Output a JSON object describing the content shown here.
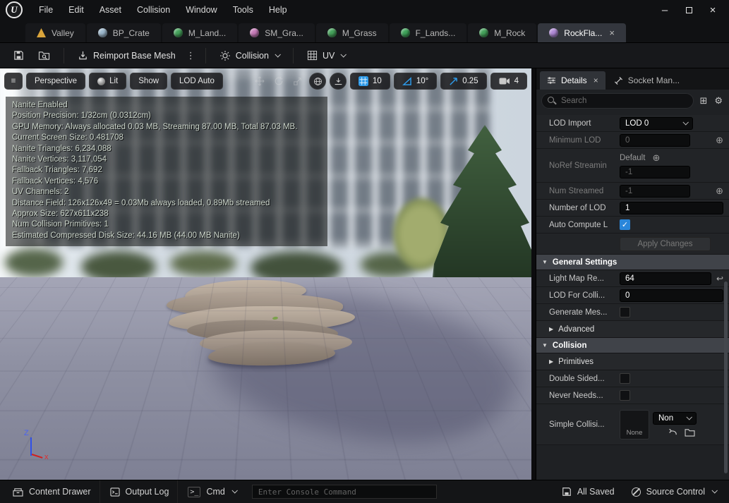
{
  "icons": {
    "logo_letter": "U",
    "hamburger": "≡",
    "gear": "⚙",
    "plus_circle": "⊕",
    "reset_arrow": "↩",
    "kebab": "⋮",
    "check": "✓",
    "close": "×",
    "minimize": "–",
    "caret_down": "▼",
    "caret_right": "▶",
    "prompt": ">_",
    "squares": "⊞"
  },
  "titlebar": {
    "menus": [
      "File",
      "Edit",
      "Asset",
      "Collision",
      "Window",
      "Tools",
      "Help"
    ]
  },
  "asset_tabs": [
    {
      "label": "Valley",
      "color": "#d9a43b",
      "active": false
    },
    {
      "label": "BP_Crate",
      "color": "#9db8cc",
      "active": false
    },
    {
      "label": "M_Land...",
      "color": "#46a35c",
      "active": false
    },
    {
      "label": "SM_Gra...",
      "color": "#c77bb8",
      "active": false
    },
    {
      "label": "M_Grass",
      "color": "#46a35c",
      "active": false
    },
    {
      "label": "F_Lands...",
      "color": "#3fa35a",
      "active": false
    },
    {
      "label": "M_Rock",
      "color": "#46a35c",
      "active": false
    },
    {
      "label": "RockFla...",
      "color": "#b08ad6",
      "active": true
    }
  ],
  "toolbar": {
    "reimport_label": "Reimport Base Mesh",
    "collision_label": "Collision",
    "uv_label": "UV"
  },
  "viewport": {
    "menu_buttons": {
      "perspective": "Perspective",
      "lit": "Lit",
      "show": "Show",
      "lod": "LOD Auto"
    },
    "snap": {
      "grid": "10",
      "angle": "10°",
      "scale": "0.25",
      "camera_speed": "4"
    },
    "stats": [
      "Nanite Enabled",
      "Position Precision: 1/32cm (0.0312cm)",
      "GPU Memory: Always allocated 0.03 MB, Streaming 87.00 MB, Total 87.03 MB.",
      "Current Screen Size: 0.481708",
      "Nanite Triangles: 6,234,088",
      "Nanite Vertices: 3,117,054",
      "Fallback Triangles: 7,692",
      "Fallback Vertices: 4,576",
      "UV Channels: 2",
      "Distance Field: 126x126x49 = 0.03Mb always loaded, 0.89Mb streamed",
      "Approx Size: 627x611x238",
      "Num Collision Primitives: 1",
      "Estimated Compressed Disk Size: 44.16 MB (44.00 MB Nanite)"
    ],
    "axis": {
      "z": "Z",
      "x": "x"
    }
  },
  "details_panel": {
    "tabs": [
      {
        "label": "Details",
        "active": true
      },
      {
        "label": "Socket Man...",
        "active": false
      }
    ],
    "search_placeholder": "Search",
    "lod_import": {
      "label": "LOD Import",
      "value": "LOD 0"
    },
    "minimum_lod": {
      "label": "Minimum LOD",
      "value": "0"
    },
    "noref_streaming": {
      "label": "NoRef Streamin",
      "default_label": "Default",
      "value": "-1"
    },
    "num_streamed": {
      "label": "Num Streamed",
      "value": "-1"
    },
    "number_of_lod": {
      "label": "Number of LOD",
      "value": "1"
    },
    "auto_compute": {
      "label": "Auto Compute L",
      "checked": true
    },
    "apply_changes_label": "Apply Changes",
    "general_settings_label": "General Settings",
    "light_map": {
      "label": "Light Map Re...",
      "value": "64"
    },
    "lod_for_collision": {
      "label": "LOD For Colli...",
      "value": "0"
    },
    "generate_mesh": {
      "label": "Generate Mes...",
      "checked": false
    },
    "advanced_label": "Advanced",
    "collision_label": "Collision",
    "primitives_label": "Primitives",
    "double_sided": {
      "label": "Double Sided...",
      "checked": false
    },
    "never_needs": {
      "label": "Never Needs...",
      "checked": false
    },
    "simple_collision": {
      "label": "Simple Collisi...",
      "thumb_label": "None",
      "dropdown_value": "Non"
    }
  },
  "status_bar": {
    "content_drawer": "Content Drawer",
    "output_log": "Output Log",
    "cmd": "Cmd",
    "console_placeholder": "Enter Console Command",
    "all_saved": "All Saved",
    "source_control": "Source Control"
  },
  "colors": {
    "accent_blue": "#2e9ae8",
    "checkbox_blue": "#2a86da",
    "ground": "#8e90a2",
    "stats_text": "#ccd6cb"
  }
}
